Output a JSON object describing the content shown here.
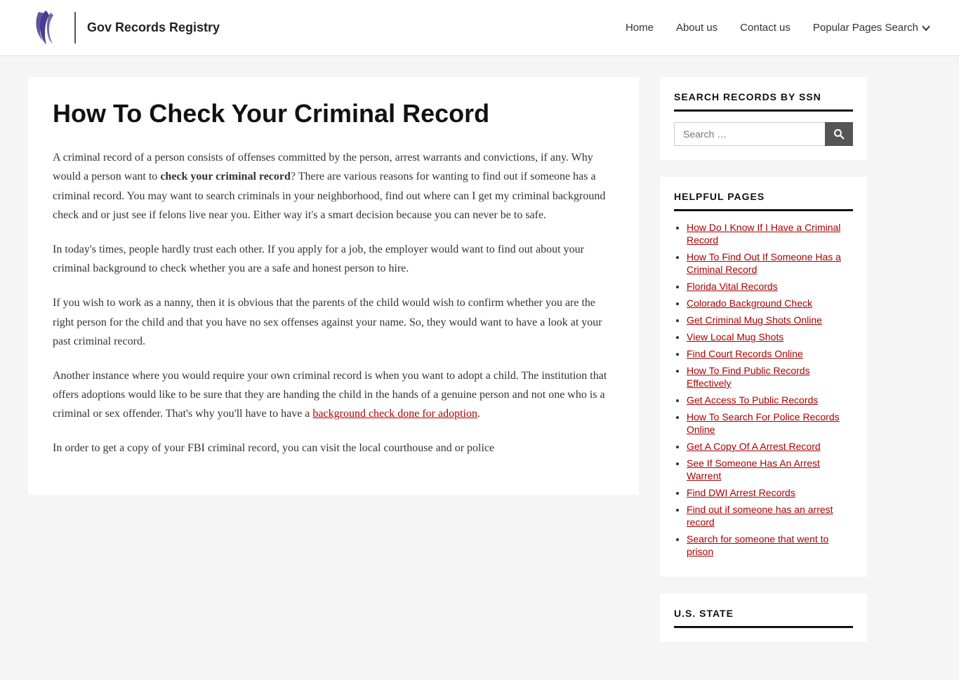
{
  "header": {
    "logo_text": "Gov Records Registry",
    "nav_items": [
      {
        "label": "Home",
        "name": "nav-home"
      },
      {
        "label": "About us",
        "name": "nav-about"
      },
      {
        "label": "Contact us",
        "name": "nav-contact"
      },
      {
        "label": "Popular Pages Search",
        "name": "nav-popular"
      }
    ]
  },
  "main": {
    "title": "How To Check Your Criminal Record",
    "paragraphs": [
      {
        "id": "p1",
        "parts": [
          {
            "text": "A criminal record of a person consists of offenses committed by the person, arrest warrants and convictions, if any. Why would a person want to ",
            "bold": false
          },
          {
            "text": "check your criminal record",
            "bold": true
          },
          {
            "text": "? There are various reasons for wanting to find out if someone has a criminal record. You may want to search criminals in your neighborhood, find out where can I get my criminal background check and or just see if felons live near you. Either way it's a smart decision because you can never be to safe.",
            "bold": false
          }
        ]
      },
      {
        "id": "p2",
        "text": "In today's times, people hardly trust each other. If you apply for a job, the employer would want to find out about your criminal background to check whether you are a safe and honest person to hire."
      },
      {
        "id": "p3",
        "text": "If you wish to work as a nanny, then it is obvious that the parents of the child would wish to confirm whether you are the right person for the child and that you have no sex offenses against your name. So, they would want to have a look at your past criminal record."
      },
      {
        "id": "p4",
        "parts": [
          {
            "text": "Another instance where you would require your own criminal record is when you want to adopt a child. The institution that offers adoptions would like to be sure that they are handing the child in the hands of a genuine person and not one who is a criminal or sex offender. That's why you'll have to have a ",
            "bold": false
          },
          {
            "text": "background check done for adoption",
            "bold": false,
            "link": true
          },
          {
            "text": ".",
            "bold": false
          }
        ]
      },
      {
        "id": "p5",
        "text": "In order to get a copy of your FBI criminal record, you can visit the local courthouse and or police"
      }
    ]
  },
  "sidebar": {
    "search_widget": {
      "title": "SEARCH RECORDS BY SSN",
      "placeholder": "Search …",
      "button_label": "Search"
    },
    "helpful_pages": {
      "title": "HELPFUL PAGES",
      "links": [
        "How Do I Know If I Have a Criminal Record",
        "How To Find Out If Someone Has a Criminal Record",
        "Florida Vital Records",
        "Colorado Background Check",
        "Get Criminal Mug Shots Online",
        "View Local Mug Shots",
        "Find Court Records Online",
        "How To Find Public Records Effectively",
        "Get Access To Public Records",
        "How To Search For Police Records Online",
        "Get A Copy Of A Arrest Record",
        "See If Someone Has An Arrest Warrent",
        "Find DWI Arrest Records",
        "Find out if someone has an arrest record",
        "Search for someone that went to prison"
      ]
    },
    "us_state": {
      "title": "U.S. STATE"
    }
  }
}
